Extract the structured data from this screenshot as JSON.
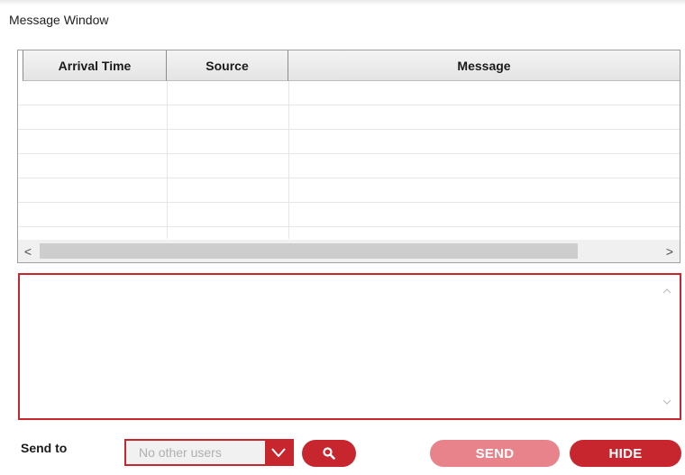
{
  "window": {
    "title": "Message Window"
  },
  "message_table": {
    "columns": [
      "Arrival Time",
      "Source",
      "Message"
    ],
    "rows": [],
    "scroll_left_glyph": "<",
    "scroll_right_glyph": ">"
  },
  "compose": {
    "value": "",
    "scroll_up_glyph": "^",
    "scroll_down_glyph": "v"
  },
  "footer": {
    "send_to_label": "Send to",
    "recipient": {
      "selected": "No other users",
      "options": [
        "No other users"
      ]
    },
    "search_icon": "search-icon",
    "send_label": "SEND",
    "hide_label": "HIDE"
  },
  "colors": {
    "accent": "#c8262f",
    "accent_disabled": "#e8838b",
    "header_bg": "#e8e8e8",
    "scrollbar_bg": "#f0f0f0",
    "scrollbar_thumb": "#cdcdcd"
  }
}
